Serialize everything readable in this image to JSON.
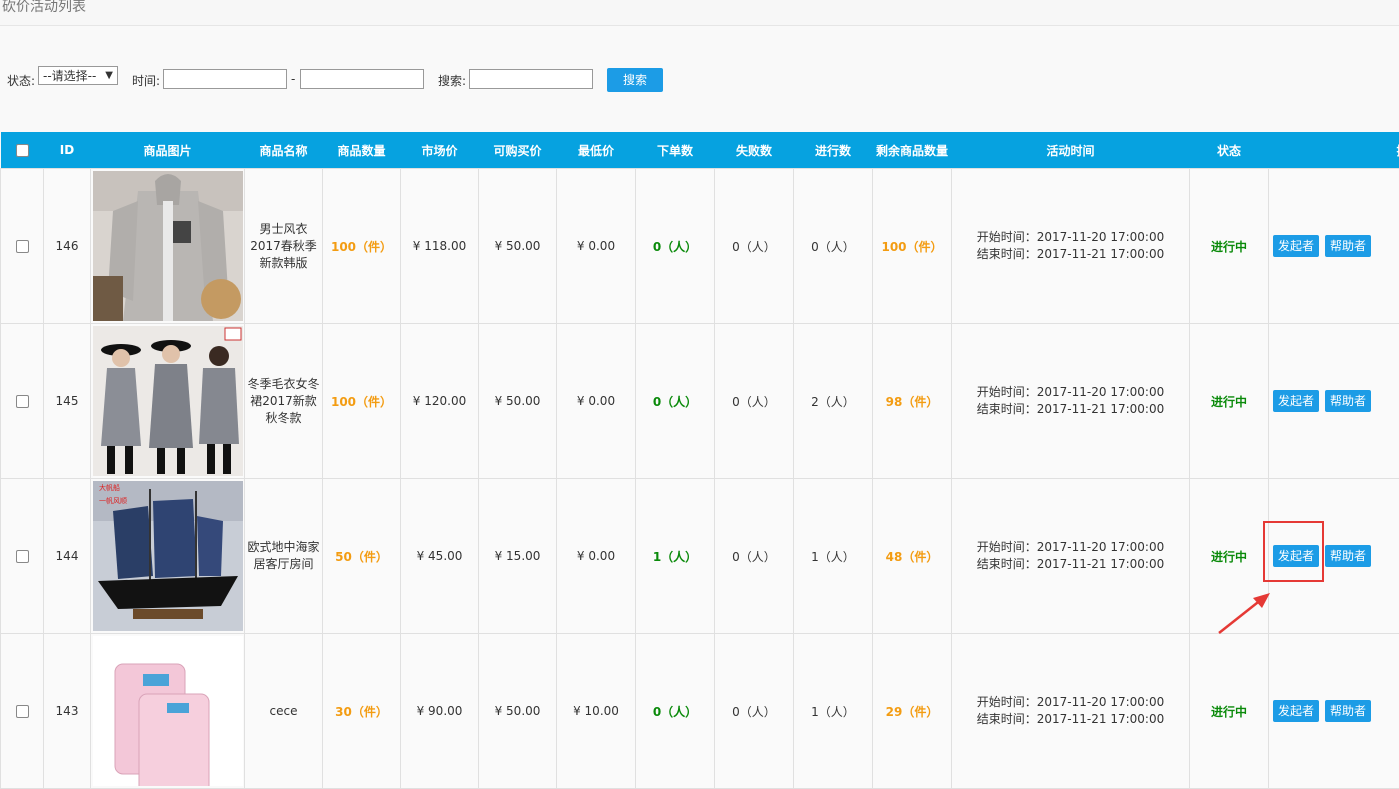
{
  "page_title": "砍价活动列表",
  "filters": {
    "status_label": "状态:",
    "status_value": "--请选择--",
    "time_label": "时间:",
    "time_sep": "-",
    "search_label": "搜索:",
    "search_button": "搜索"
  },
  "columns": [
    "ID",
    "商品图片",
    "商品名称",
    "商品数量",
    "市场价",
    "可购买价",
    "最低价",
    "下单数",
    "失败数",
    "进行数",
    "剩余商品数量",
    "活动时间",
    "状态",
    "操作"
  ],
  "rows": [
    {
      "id": "146",
      "name": "男士风衣2017春秋季新款韩版",
      "qty": "100（件）",
      "market": "¥ 118.00",
      "buy": "¥ 50.00",
      "min": "¥ 0.00",
      "orders": "0（人）",
      "fail": "0（人）",
      "ongoing": "0（人）",
      "remain": "100（件）",
      "start": "开始时间：2017-11-20 17:00:00",
      "end": "结束时间：2017-11-21 17:00:00",
      "status": "进行中",
      "btn1": "发起者",
      "btn2": "帮助者"
    },
    {
      "id": "145",
      "name": "冬季毛衣女冬裙2017新款秋冬款",
      "qty": "100（件）",
      "market": "¥ 120.00",
      "buy": "¥ 50.00",
      "min": "¥ 0.00",
      "orders": "0（人）",
      "fail": "0（人）",
      "ongoing": "2（人）",
      "remain": "98（件）",
      "start": "开始时间：2017-11-20 17:00:00",
      "end": "结束时间：2017-11-21 17:00:00",
      "status": "进行中",
      "btn1": "发起者",
      "btn2": "帮助者"
    },
    {
      "id": "144",
      "name": "欧式地中海家居客厅房间",
      "qty": "50（件）",
      "market": "¥ 45.00",
      "buy": "¥ 15.00",
      "min": "¥ 0.00",
      "orders": "1（人）",
      "fail": "0（人）",
      "ongoing": "1（人）",
      "remain": "48（件）",
      "start": "开始时间：2017-11-20 17:00:00",
      "end": "结束时间：2017-11-21 17:00:00",
      "status": "进行中",
      "btn1": "发起者",
      "btn2": "帮助者"
    },
    {
      "id": "143",
      "name": "cece",
      "qty": "30（件）",
      "market": "¥ 90.00",
      "buy": "¥ 50.00",
      "min": "¥ 10.00",
      "orders": "0（人）",
      "fail": "0（人）",
      "ongoing": "1（人）",
      "remain": "29（件）",
      "start": "开始时间：2017-11-20 17:00:00",
      "end": "结束时间：2017-11-21 17:00:00",
      "status": "进行中",
      "btn1": "发起者",
      "btn2": "帮助者"
    }
  ],
  "colors": {
    "header": "#06a2e0",
    "button": "#1c9ce6",
    "orange": "#f39c12",
    "green": "#0a8a0a",
    "highlight": "#e53935"
  }
}
